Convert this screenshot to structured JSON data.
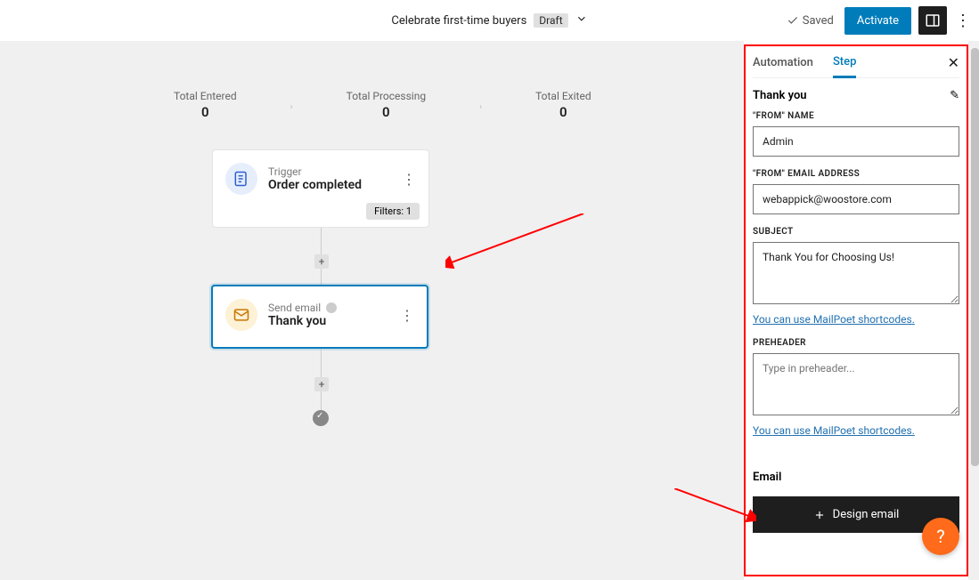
{
  "header": {
    "title": "Celebrate first-time buyers",
    "status_badge": "Draft",
    "saved_label": "Saved",
    "activate_label": "Activate"
  },
  "stats": [
    {
      "label": "Total Entered",
      "value": "0"
    },
    {
      "label": "Total Processing",
      "value": "0"
    },
    {
      "label": "Total Exited",
      "value": "0"
    }
  ],
  "trigger_card": {
    "label": "Trigger",
    "title": "Order completed",
    "filters": "Filters: 1"
  },
  "email_card": {
    "label": "Send email",
    "title": "Thank you"
  },
  "sidebar": {
    "tab_automation": "Automation",
    "tab_step": "Step",
    "step_name": "Thank you",
    "from_name_label": "\"FROM\" NAME",
    "from_name_value": "Admin",
    "from_email_label": "\"FROM\" EMAIL ADDRESS",
    "from_email_value": "webappick@woostore.com",
    "subject_label": "SUBJECT",
    "subject_value": "Thank You for Choosing Us!",
    "shortcodes_link": "You can use MailPoet shortcodes.",
    "preheader_label": "PREHEADER",
    "preheader_placeholder": "Type in preheader...",
    "email_heading": "Email",
    "design_button": "Design email"
  }
}
